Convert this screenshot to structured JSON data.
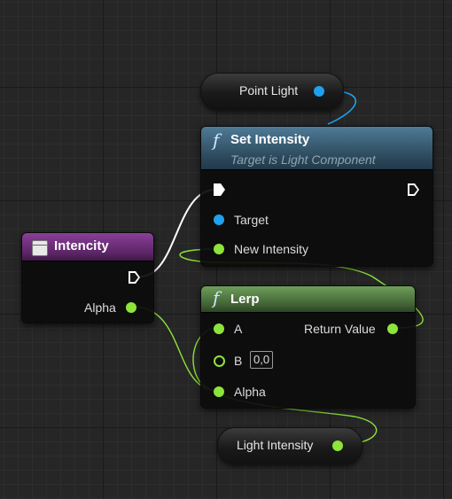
{
  "nodes": {
    "point_light": {
      "label": "Point Light"
    },
    "set_intensity": {
      "title": "Set Intensity",
      "subtitle": "Target is Light Component",
      "pin_target": "Target",
      "pin_new_intensity": "New Intensity"
    },
    "intencity": {
      "title": "Intencity",
      "pin_alpha": "Alpha"
    },
    "lerp": {
      "title": "Lerp",
      "pin_a": "A",
      "pin_b": "B",
      "b_default": "0,0",
      "pin_alpha": "Alpha",
      "pin_return": "Return Value"
    },
    "light_intensity": {
      "label": "Light Intensity"
    }
  },
  "icons": {
    "function": "f"
  },
  "colors": {
    "float_pin": "#8de43a",
    "object_pin": "#1ea1ee",
    "exec_wire": "#ffffff",
    "function_header": "#3f6a86",
    "pure_function_header": "#5a8a4a",
    "struct_header": "#6d2e7a"
  }
}
